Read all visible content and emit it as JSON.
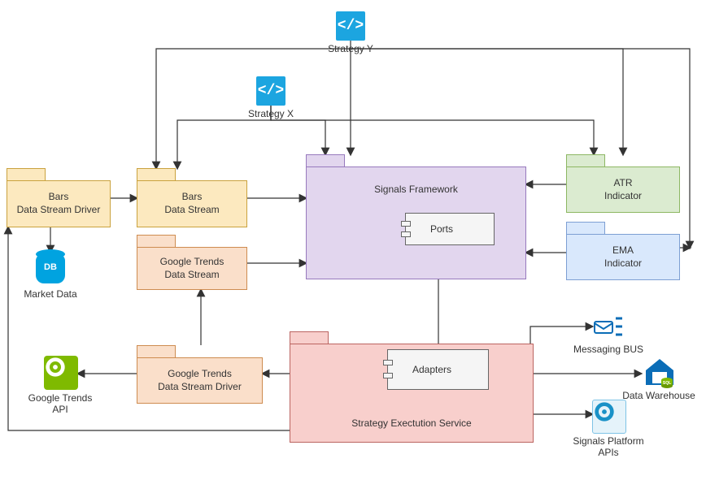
{
  "nodes": {
    "strategyY": "Strategy Y",
    "strategyX": "Strategy X",
    "barsDriver": "Bars\nData Stream Driver",
    "marketData": "Market Data",
    "barsStream": "Bars\nData Stream",
    "gtStream": "Google Trends\nData Stream",
    "gtDriver": "Google Trends\nData Stream Driver",
    "gtApi": "Google Trends\nAPI",
    "signals": "Signals Framework",
    "ports": "Ports",
    "atr": "ATR\nIndicator",
    "ema": "EMA\nIndicator",
    "ses": "Strategy Exectution Service",
    "adapters": "Adapters",
    "msgBus": "Messaging BUS",
    "dw": "Data Warehouse",
    "spApi": "Signals Platform\nAPIs"
  }
}
